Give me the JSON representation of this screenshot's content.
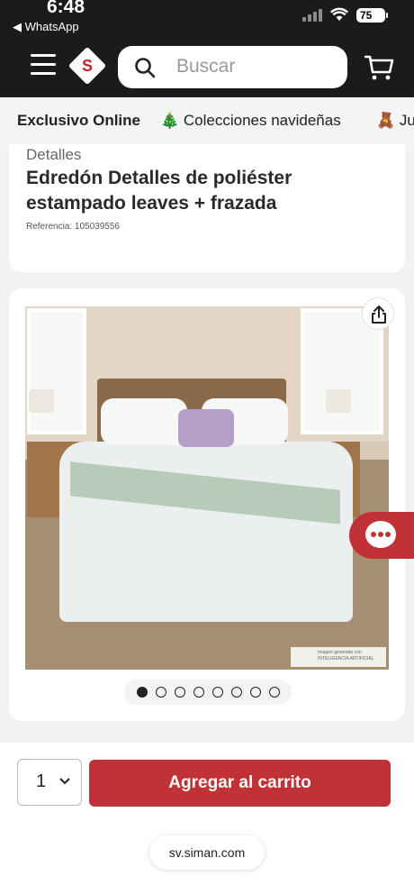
{
  "status_bar": {
    "time": "6:48",
    "back_app": "◀ WhatsApp",
    "battery": "75"
  },
  "header": {
    "logo_letter": "S",
    "search_placeholder": "Buscar"
  },
  "promo_bar": {
    "items": [
      {
        "label": "Exclusivo Online"
      },
      {
        "label": "🎄 Colecciones navideñas"
      },
      {
        "label": "🧸 Ju"
      }
    ]
  },
  "product": {
    "breadcrumb": "Detalles",
    "title": "Edredón Detalles de poliéster estampado leaves + frazada",
    "reference": "Referencia: 105039556",
    "image_watermark": "Imagen generada con INTELIGENCIA ARTIFICIAL",
    "carousel": {
      "total": 8,
      "current": 1
    }
  },
  "purchase": {
    "quantity": "1",
    "add_to_cart_label": "Agregar al carrito"
  },
  "browser": {
    "url": "sv.siman.com"
  },
  "colors": {
    "brand_red": "#c13237",
    "header_bg": "#1b1b1b"
  }
}
